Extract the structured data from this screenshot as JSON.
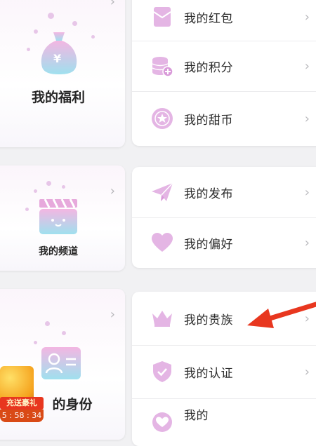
{
  "welfare": {
    "title": "我的福利",
    "bag_symbol": "¥",
    "items": [
      {
        "label": "我的红包",
        "icon": "red-packet-icon"
      },
      {
        "label": "我的积分",
        "icon": "points-icon"
      },
      {
        "label": "我的甜币",
        "icon": "sweet-coin-icon"
      }
    ]
  },
  "channel": {
    "title": "我的频道",
    "items": [
      {
        "label": "我的发布",
        "icon": "paper-plane-icon"
      },
      {
        "label": "我的偏好",
        "icon": "heart-icon"
      }
    ]
  },
  "identity": {
    "title": "我的身份",
    "title_visible": "的身份",
    "items": [
      {
        "label": "我的贵族",
        "icon": "crown-icon"
      },
      {
        "label": "我的认证",
        "icon": "shield-check-icon"
      },
      {
        "label": "我的",
        "icon": "heart-shield-icon"
      }
    ]
  },
  "gift_popup": {
    "label": "充送豪礼",
    "timer": "5 : 58 : 34"
  },
  "chevron": "›",
  "colors": {
    "icon_pink": "#e4b5e4",
    "icon_gradient_top": "#f3b6e2",
    "icon_gradient_bottom": "#9fe0ee",
    "arrow_red": "#e8371f"
  }
}
